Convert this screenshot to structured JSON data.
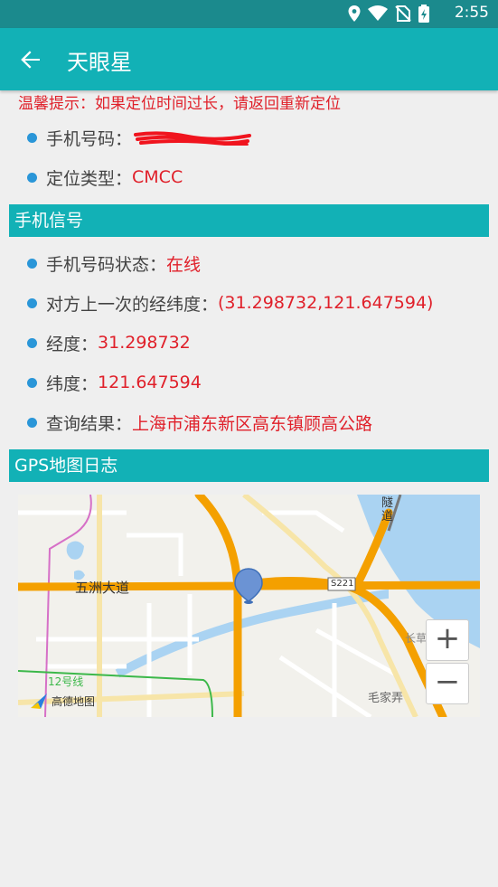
{
  "status_bar": {
    "time": "2:55",
    "icons": [
      "location-icon",
      "wifi-icon",
      "no-sim-icon",
      "battery-charging-icon"
    ]
  },
  "app_bar": {
    "title": "天眼星",
    "back_icon": "arrow-left-icon"
  },
  "tip": "温馨提示：如果定位时间过长，请返回重新定位",
  "info": {
    "phone_label": "手机号码：",
    "type_label": "定位类型：",
    "type_value": "CMCC"
  },
  "signal_section": {
    "header": "手机信号",
    "status_label": "手机号码状态：",
    "status_value": "在线",
    "last_coord_label": "对方上一次的经纬度：",
    "last_coord_value": "(31.298732,121.647594)",
    "lng_label": "经度：",
    "lng_value": "31.298732",
    "lat_label": "纬度：",
    "lat_value": "121.647594",
    "result_label": "查询结果：",
    "result_value": "上海市浦东新区高东镇顾高公路"
  },
  "gps_section": {
    "header": "GPS地图日志",
    "map": {
      "road_main": "五洲大道",
      "road_s221": "S221",
      "road_tunnel": "隧道",
      "metro": "12号线",
      "village": "毛家弄",
      "place_partial": "长草陆",
      "brand": "高德地图",
      "zoom_in": "+",
      "zoom_out": "−"
    }
  }
}
